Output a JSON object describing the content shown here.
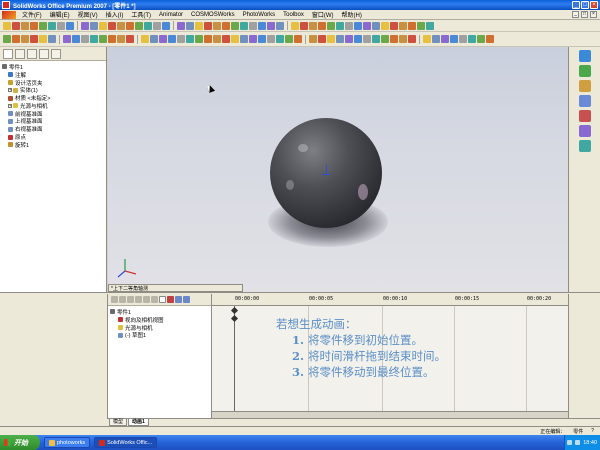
{
  "window": {
    "title": "SolidWorks Office Premium 2007 - [零件1 *]"
  },
  "menu": {
    "items": [
      "文件(F)",
      "编辑(E)",
      "视图(V)",
      "插入(I)",
      "工具(T)",
      "Animator",
      "COSMOSWorks",
      "PhotoWorks",
      "Toolbox",
      "窗口(W)",
      "帮助(H)"
    ]
  },
  "feature_tree": {
    "items": [
      {
        "label": "零件1",
        "icon": "part-icon",
        "color": "#6b6b6b"
      },
      {
        "label": "注解",
        "icon": "annotation-icon",
        "color": "#3a78c8"
      },
      {
        "label": "设计活页夹",
        "icon": "binder-icon",
        "color": "#c8a030"
      },
      {
        "label": "实体(1)",
        "icon": "solid-icon",
        "color": "#d0b040"
      },
      {
        "label": "材质 <未指定>",
        "icon": "material-icon",
        "color": "#b05030"
      },
      {
        "label": "光源与相机",
        "icon": "lights-icon",
        "color": "#e0c040"
      },
      {
        "label": "前视基准面",
        "icon": "plane-icon",
        "color": "#7090c0"
      },
      {
        "label": "上视基准面",
        "icon": "plane-icon",
        "color": "#7090c0"
      },
      {
        "label": "右视基准面",
        "icon": "plane-icon",
        "color": "#7090c0"
      },
      {
        "label": "原点",
        "icon": "origin-icon",
        "color": "#c03030"
      },
      {
        "label": "旋转1",
        "icon": "revolve-icon",
        "color": "#c09030"
      }
    ]
  },
  "viewport": {
    "view_select": "*上下二等角轴测"
  },
  "animation_tree": {
    "items": [
      {
        "label": "零件1",
        "icon": "part-icon"
      },
      {
        "label": "视向及相机视图",
        "icon": "camera-icon"
      },
      {
        "label": "光源与相机",
        "icon": "lights-icon"
      },
      {
        "label": "(-) 草图1",
        "icon": "sketch-icon"
      }
    ]
  },
  "timeline": {
    "ticks": [
      "00:00:00",
      "00:00:05",
      "00:00:10",
      "00:00:15",
      "00:00:20"
    ]
  },
  "annotation": {
    "title": "若想生成动画：",
    "steps": [
      {
        "num": "1.",
        "text": "将零件移到初始位置。"
      },
      {
        "num": "2.",
        "text": "将时间滑杆拖到结束时间。"
      },
      {
        "num": "3.",
        "text": "将零件移动到最终位置。"
      }
    ]
  },
  "bottom_tabs": [
    "模型",
    "动画1"
  ],
  "status": {
    "left": "",
    "mode": "正在编辑：",
    "doc": "零件",
    "help": "?"
  },
  "taskbar": {
    "start": "开始",
    "tasks": [
      "photoworks",
      "SolidWorks Offic..."
    ],
    "clock": "18:40"
  },
  "colors": {
    "title_blue": "#0a5fd8",
    "annotation": "#5a8fc8"
  }
}
